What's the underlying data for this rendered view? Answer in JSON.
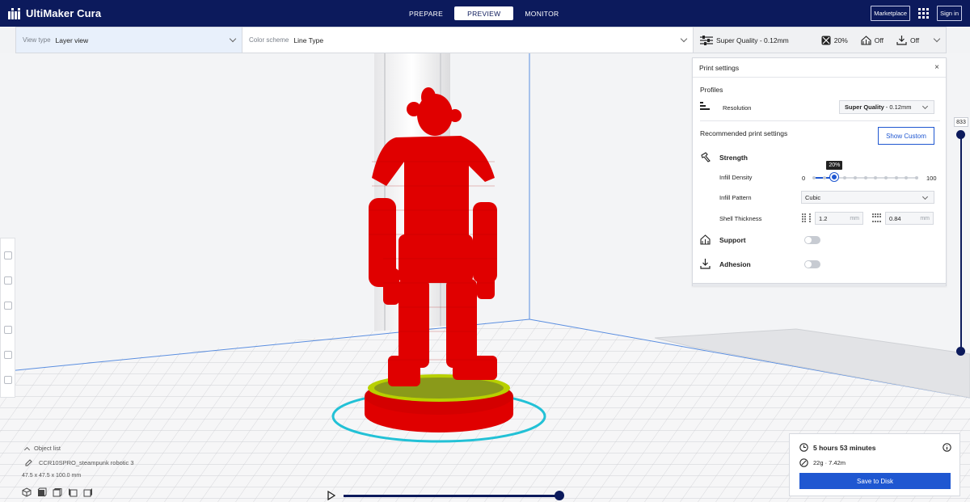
{
  "app": {
    "brand": "UltiMaker Cura",
    "colors": {
      "topbar": "#0c1a5c",
      "accent": "#1f57d1",
      "model": "#e00000",
      "buildplate_outline": "#22c1d6"
    }
  },
  "nav": {
    "tabs": [
      {
        "label": "PREPARE"
      },
      {
        "label": "PREVIEW",
        "active": true
      },
      {
        "label": "MONITOR"
      }
    ]
  },
  "topright": {
    "marketplace": "Marketplace",
    "signin": "Sign in",
    "apps_icon": "grid-icon"
  },
  "toolbar": {
    "view_type_label": "View type",
    "view_type_value": "Layer view",
    "color_scheme_label": "Color scheme",
    "color_scheme_value": "Line Type",
    "quality": "Super Quality - 0.12mm",
    "infill": "20%",
    "support": "Off",
    "adhesion": "Off"
  },
  "print_settings": {
    "title": "Print settings",
    "profiles_title": "Profiles",
    "resolution_label": "Resolution",
    "resolution_bold": "Super Quality",
    "resolution_rest": "- 0.12mm",
    "recommended_title": "Recommended print settings",
    "show_custom": "Show Custom",
    "strength_title": "Strength",
    "infill_density_label": "Infill Density",
    "infill_min": "0",
    "infill_max": "100",
    "infill_value": 20,
    "infill_tip": "20%",
    "infill_pattern_label": "Infill Pattern",
    "infill_pattern_value": "Cubic",
    "shell_thickness_label": "Shell Thickness",
    "wall_value": "1.2",
    "top_bottom_value": "0.84",
    "unit": "mm",
    "support_title": "Support",
    "support_enabled": false,
    "adhesion_title": "Adhesion",
    "adhesion_enabled": false
  },
  "layer_slider": {
    "top_value": "833"
  },
  "object_list": {
    "toggle": "Object list",
    "object_name": "CCR10SPRO_steampunk robotic 3",
    "dimensions": "47.5 x 47.5 x 100.0 mm"
  },
  "estimate": {
    "time": "5 hours 53 minutes",
    "material": "22g · 7.42m",
    "save": "Save to Disk"
  }
}
